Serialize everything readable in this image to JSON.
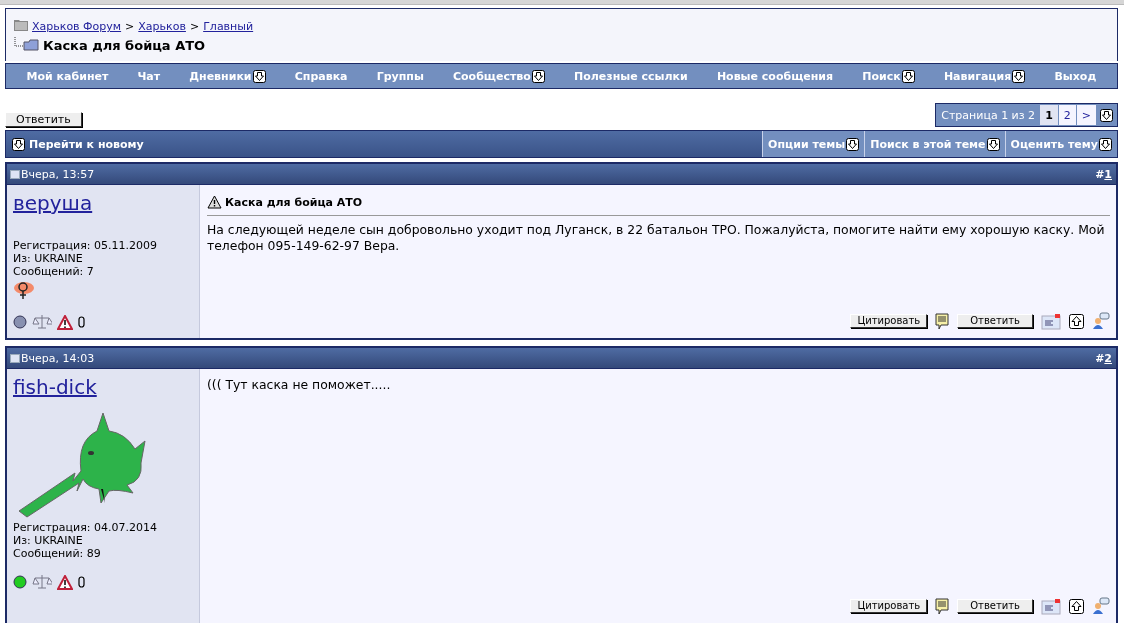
{
  "breadcrumb": {
    "links": [
      "Харьков Форум",
      "Харьков",
      "Главный"
    ],
    "separator": ">",
    "title": "Каска для бойца АТО"
  },
  "nav": [
    {
      "label": "Мой кабинет",
      "dropdown": false
    },
    {
      "label": "Чат",
      "dropdown": false
    },
    {
      "label": "Дневники",
      "dropdown": true
    },
    {
      "label": "Справка",
      "dropdown": false
    },
    {
      "label": "Группы",
      "dropdown": false
    },
    {
      "label": "Сообщество",
      "dropdown": true
    },
    {
      "label": "Полезные ссылки",
      "dropdown": false
    },
    {
      "label": "Новые сообщения",
      "dropdown": false
    },
    {
      "label": "Поиск",
      "dropdown": true
    },
    {
      "label": "Навигация",
      "dropdown": true
    },
    {
      "label": "Выход",
      "dropdown": false
    }
  ],
  "reply_button": "Ответить",
  "pagination": {
    "label": "Страница 1 из 2",
    "pages": [
      {
        "label": "1",
        "selected": true
      },
      {
        "label": "2",
        "selected": false
      },
      {
        "label": ">",
        "selected": false
      }
    ]
  },
  "thread_toolbar": {
    "goto_new": "Перейти к новому",
    "menus": [
      "Опции темы",
      "Поиск в этой теме",
      "Оценить тему"
    ]
  },
  "posts": [
    {
      "date": "Вчера, 13:57",
      "number_prefix": "#",
      "number": "1",
      "username": "веруша",
      "avatar": {
        "kind": "gender-mark"
      },
      "registration": "Регистрация: 05.11.2009",
      "location": "Из: UKRAINE",
      "messages": "Сообщений: 7",
      "online": false,
      "title": "Каска для бойца АТО",
      "text": "На следующей неделе сын добровольно уходит под Луганск, в 22 батальон ТРО. Пожалуйста, помогите найти ему хорошую каску. Мой телефон 095-149-62-97 Вера.",
      "buttons": [
        "Цитировать",
        "Ответить"
      ]
    },
    {
      "date": "Вчера, 14:03",
      "number_prefix": "#",
      "number": "2",
      "username": "fish-dick",
      "avatar": {
        "kind": "picture"
      },
      "registration": "Регистрация: 04.07.2014",
      "location": "Из: UKRAINE",
      "messages": "Сообщений: 89",
      "online": true,
      "text": "((( Тут каска не поможет.....",
      "buttons": [
        "Цитировать",
        "Ответить"
      ]
    }
  ]
}
